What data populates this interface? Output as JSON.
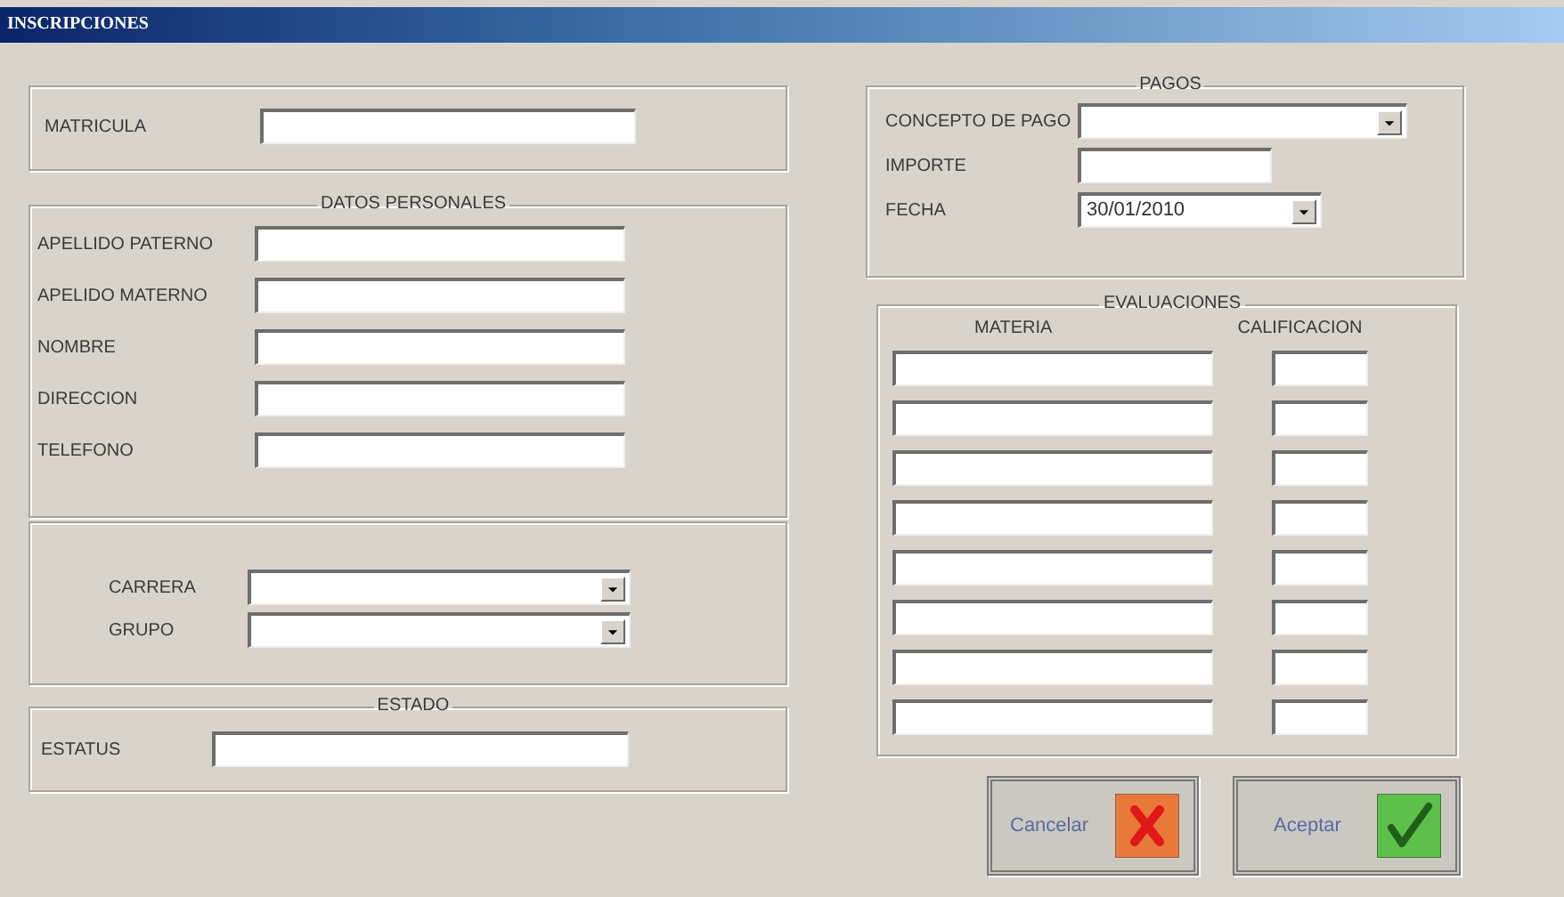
{
  "window": {
    "title": "INSCRIPCIONES"
  },
  "matricula": {
    "fields": [
      {
        "label": "MATRICULA"
      }
    ]
  },
  "datos_personales": {
    "title": "DATOS PERSONALES",
    "fields": [
      {
        "label": "APELLIDO PATERNO"
      },
      {
        "label": "APELIDO MATERNO"
      },
      {
        "label": "NOMBRE"
      },
      {
        "label": "DIRECCION"
      },
      {
        "label": "TELEFONO"
      }
    ]
  },
  "carrera": {
    "fields": [
      {
        "label": "CARRERA",
        "kind": "dropdown"
      },
      {
        "label": "GRUPO",
        "kind": "dropdown"
      }
    ]
  },
  "estado": {
    "title": "ESTADO",
    "fields": [
      {
        "label": "ESTATUS"
      }
    ]
  },
  "pagos": {
    "title": "PAGOS",
    "fields": [
      {
        "label": "CONCEPTO DE PAGO",
        "kind": "dropdown"
      },
      {
        "label": "IMPORTE",
        "kind": "short"
      },
      {
        "label": "FECHA",
        "kind": "date",
        "value": "30/01/2010"
      }
    ]
  },
  "evaluaciones": {
    "title": "EVALUACIONES",
    "columns": [
      "MATERIA",
      "CALIFICACION"
    ],
    "rows": [
      {
        "kind": "blank"
      },
      {
        "kind": "blank"
      },
      {
        "kind": "blank"
      },
      {
        "kind": "blank"
      },
      {
        "kind": "blank"
      },
      {
        "kind": "blank"
      },
      {
        "kind": "blank"
      },
      {
        "kind": "blank"
      }
    ]
  },
  "buttons": [
    {
      "label": "Cancelar",
      "kind": "cancel"
    },
    {
      "label": "Aceptar",
      "kind": "accept"
    }
  ]
}
